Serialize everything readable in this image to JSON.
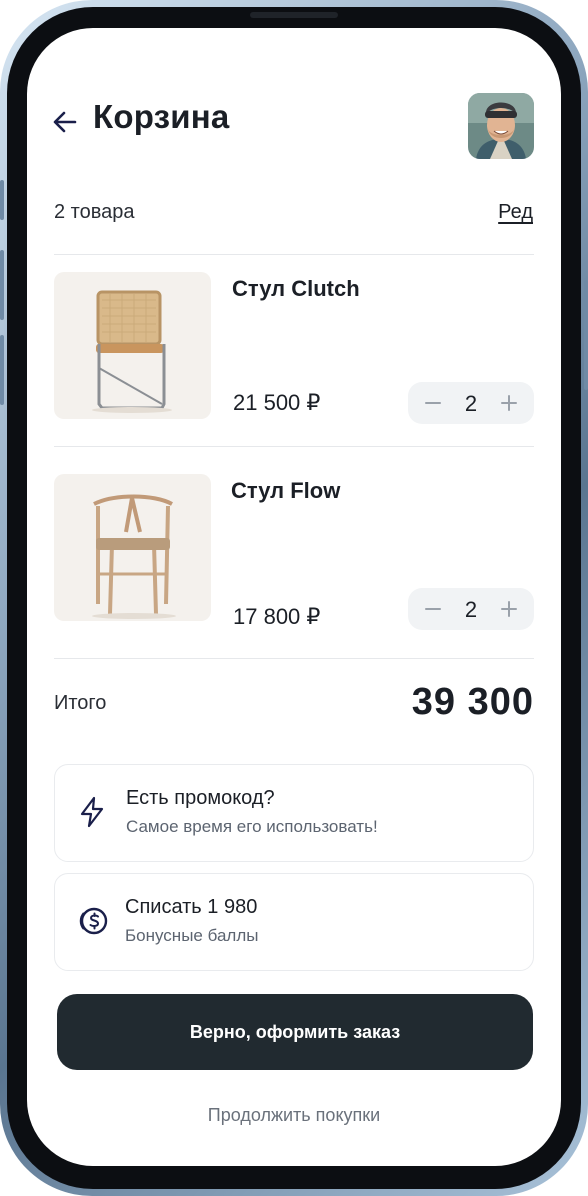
{
  "header": {
    "title": "Корзина",
    "back_icon": "arrow-left-icon",
    "avatar_icon": "user-avatar"
  },
  "summary": {
    "count": "2 товара",
    "edit_label": "Ред"
  },
  "products": [
    {
      "name": "Стул Clutch",
      "price": "21 500 ₽",
      "quantity": "2"
    },
    {
      "name": "Стул Flow",
      "price": "17 800 ₽",
      "quantity": "2"
    }
  ],
  "total": {
    "label": "Итого",
    "value": "39 300"
  },
  "promo": {
    "title": "Есть промокод?",
    "subtitle": "Самое время его использовать!",
    "icon": "lightning-icon"
  },
  "bonus": {
    "title": "Списать 1 980",
    "subtitle": "Бонусные баллы",
    "icon": "coin-icon"
  },
  "actions": {
    "checkout_label": "Верно, оформить заказ",
    "continue_label": "Продолжить покупки"
  },
  "colors": {
    "primary_button": "#212a30",
    "accent_dark": "#1a1f4a",
    "muted_text": "#6a717b"
  }
}
